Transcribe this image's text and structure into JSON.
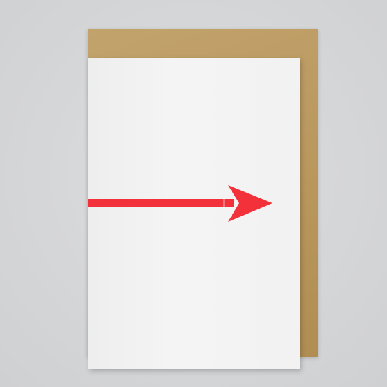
{
  "scene": {
    "background_color": "#d6d7d9",
    "envelope_color": "#bb9a61",
    "card_color": "#f2f2f2",
    "arrow_color": "#f2313a",
    "arrow_direction": "right",
    "icon": "arrow-right-icon"
  }
}
